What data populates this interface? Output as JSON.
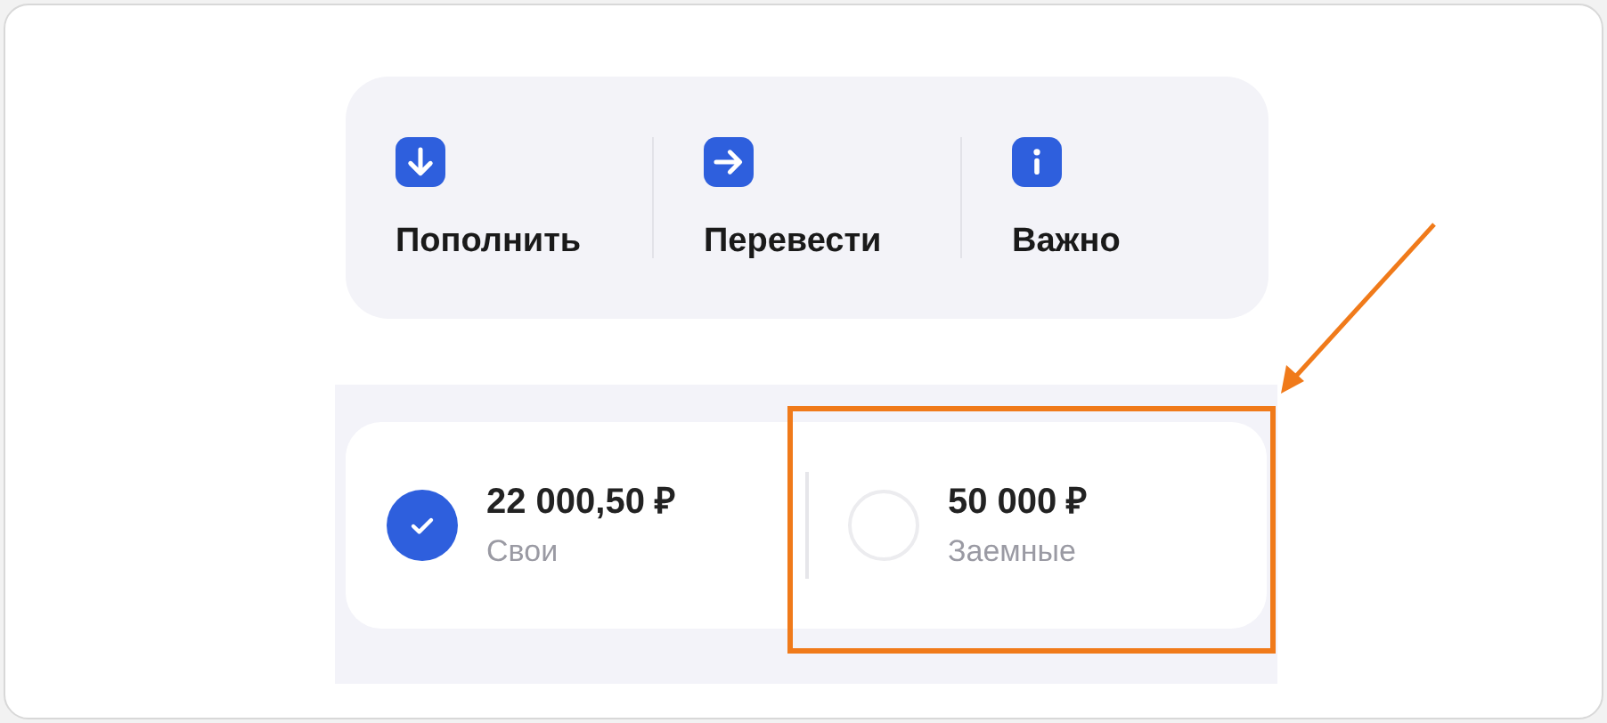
{
  "actions": [
    {
      "label": "Пополнить",
      "kind": "down"
    },
    {
      "label": "Перевести",
      "kind": "right"
    },
    {
      "label": "Важно",
      "kind": "info"
    }
  ],
  "accounts": [
    {
      "amount": "22 000,50 ₽",
      "label": "Свои",
      "selected": true
    },
    {
      "amount": "50 000 ₽",
      "label": "Заемные",
      "selected": false
    }
  ]
}
